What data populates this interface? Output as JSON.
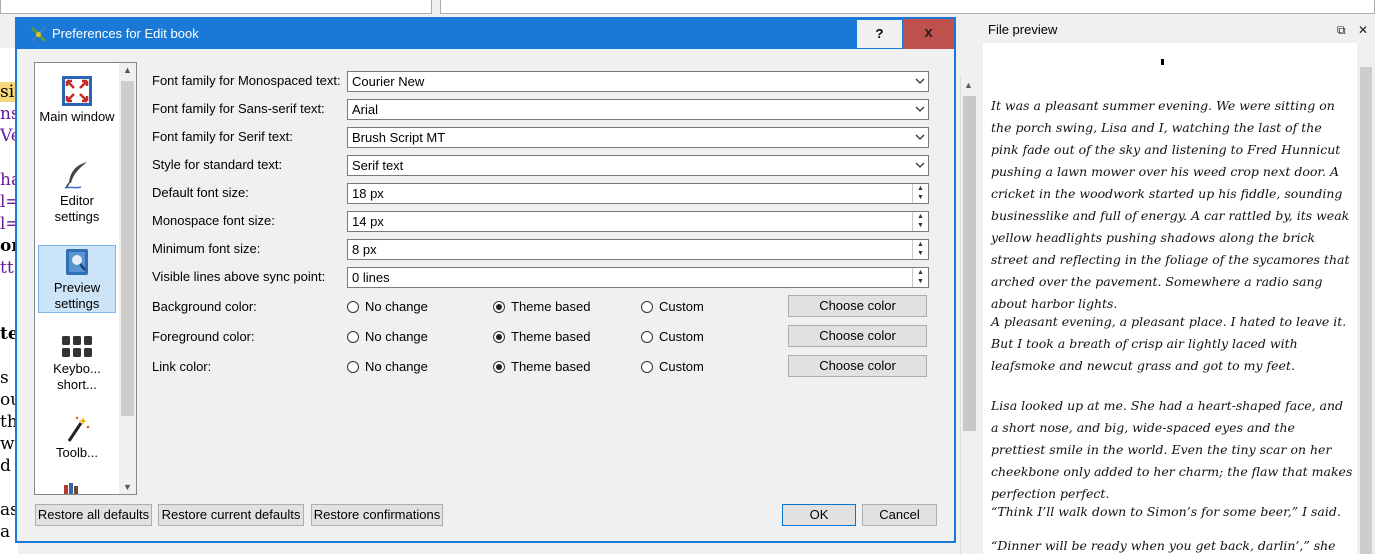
{
  "dialog": {
    "title": "Preferences for Edit book",
    "help_label": "?",
    "close_label": "x"
  },
  "sidebar": {
    "items": [
      {
        "label": "Main window",
        "icon": "main-window-icon"
      },
      {
        "label": "Editor settings",
        "icon": "feather-pen-icon"
      },
      {
        "label": "Preview settings",
        "icon": "book-preview-icon",
        "selected": true
      },
      {
        "label": "Keybo... short...",
        "icon": "keyboard-icon"
      },
      {
        "label": "Toolb...",
        "icon": "magic-wand-icon"
      }
    ]
  },
  "settings": {
    "mono_font": {
      "label": "Font family for Monospaced text:",
      "value": "Courier New"
    },
    "sans_font": {
      "label": "Font family for Sans-serif text:",
      "value": "Arial"
    },
    "serif_font": {
      "label": "Font family for Serif text:",
      "value": "Brush Script MT"
    },
    "standard_style": {
      "label": "Style for standard text:",
      "value": "Serif text"
    },
    "default_size": {
      "label": "Default font size:",
      "value": "18 px"
    },
    "mono_size": {
      "label": "Monospace font size:",
      "value": "14 px"
    },
    "min_size": {
      "label": "Minimum font size:",
      "value": "8 px"
    },
    "sync_lines": {
      "label": "Visible lines above sync point:",
      "value": "0 lines"
    }
  },
  "colors": {
    "options": {
      "no_change": "No change",
      "theme": "Theme based",
      "custom": "Custom"
    },
    "choose_label": "Choose color",
    "rows": [
      {
        "label": "Background color:",
        "selected": "theme"
      },
      {
        "label": "Foreground color:",
        "selected": "theme"
      },
      {
        "label": "Link color:",
        "selected": "theme"
      }
    ]
  },
  "footer": {
    "restore_all": "Restore all defaults",
    "restore_current": "Restore current defaults",
    "restore_confirmations": "Restore confirmations",
    "ok": "OK",
    "cancel": "Cancel"
  },
  "preview": {
    "title": "File preview",
    "paragraphs": [
      "It was a pleasant summer evening. We were sitting on the porch swing, Lisa and I, watching the last of the pink fade out of the sky and listening to Fred Hunnicut pushing a lawn mower over his weed crop next door. A cricket in the woodwork started up his fiddle, sounding businesslike and full of energy. A car rattled by, its weak yellow headlights pushing shadows along the brick street and reflecting in the foliage of the sycamores that arched over the pavement. Somewhere a radio sang about harbor lights.",
      "A pleasant evening, a pleasant place. I hated to leave it. But I took a breath of crisp air lightly laced with leafsmoke and newcut grass and got to my feet.",
      "Lisa looked up at me. She had a heart-shaped face, and a short nose, and big, wide-spaced eyes and the prettiest smile in the world. Even the tiny scar on her cheekbone only added to her charm; the flaw that makes perfection perfect.",
      "“Think I’ll walk down to Simon’s for some beer,” I said.",
      "“Dinner will be ready when you get back, darlin’,” she"
    ]
  },
  "background_editor": {
    "lines": [
      "sio",
      "ns",
      "Ver",
      "",
      "ha",
      "l=",
      "l=",
      "on",
      "tt",
      "",
      "te",
      "",
      "s a",
      "ou",
      "th",
      "w",
      "d",
      "",
      "as",
      "a"
    ]
  },
  "accent_colors": {
    "titlebar": "#1a79d6",
    "close": "#c0504d",
    "selected": "#cce4f7"
  }
}
